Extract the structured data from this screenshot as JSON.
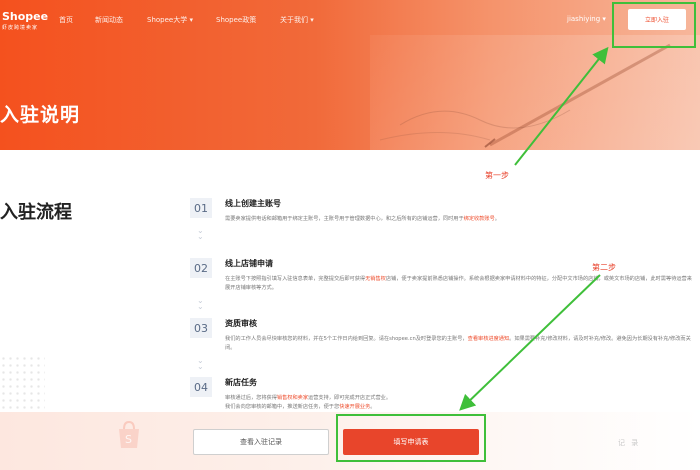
{
  "header": {
    "logo_brand": "Shopee",
    "logo_sub": "虾皮跨境卖家",
    "nav": [
      "首页",
      "新闻动态",
      "Shopee大学 ▾",
      "Shopee政策",
      "关于我们 ▾"
    ],
    "user": "jiashiying ▾",
    "join_button": "立即入驻"
  },
  "banner": {
    "title": "入驻说明"
  },
  "section": {
    "title": "入驻流程"
  },
  "steps": [
    {
      "num": "01",
      "title": "线上创建主账号",
      "desc": "需要卖家提供电话和邮箱用于绑定主账号，主账号用于管理数据中心，和之后所有的店铺运营，同时用于",
      "desc_red": "绑定收款账号",
      "desc_tail": "。"
    },
    {
      "num": "02",
      "title": "线上店铺申请",
      "desc_a": "在主账号下按照指引填写入驻信息表单，完整提交后即可获得",
      "desc_red": "无销售权",
      "desc_b": "店铺，便于卖家提前熟悉店铺操作。系统会根据卖家申请材料中的特征，分配中文市场的店铺，或英文市场的店铺，此时需等待运营来展开店铺审核等方式。"
    },
    {
      "num": "03",
      "title": "资质审核",
      "desc_a": "我们的工作人员会尽快审核您的材料，并在5个工作日内给到回复。请在shopee.cn及时登录您的主账号，",
      "desc_red": "查看审核进度通知",
      "desc_b": "。如果需要补充/修改材料，请及时补充/修改。避免因为长期没有补充/修改而关闭。"
    },
    {
      "num": "04",
      "title": "新店任务",
      "desc_a": "审核通过后，您将获得",
      "desc_red": "销售权和卖家",
      "desc_b": "运营支持，即可完成开店正式营业。",
      "desc_c": "我们会向您审核的邮箱中，推送新店任务，便于您",
      "desc_red2": "快速开展业务",
      "desc_d": "。"
    }
  ],
  "annotations": {
    "step1": "第一步",
    "step2": "第二步"
  },
  "footer": {
    "records_button": "查看入驻记录",
    "apply_button": "填写申请表",
    "watermark": "记 录"
  },
  "colors": {
    "brand": "#ee4d2d",
    "highlight": "#3fbf3a",
    "annotation": "#e8402a"
  }
}
